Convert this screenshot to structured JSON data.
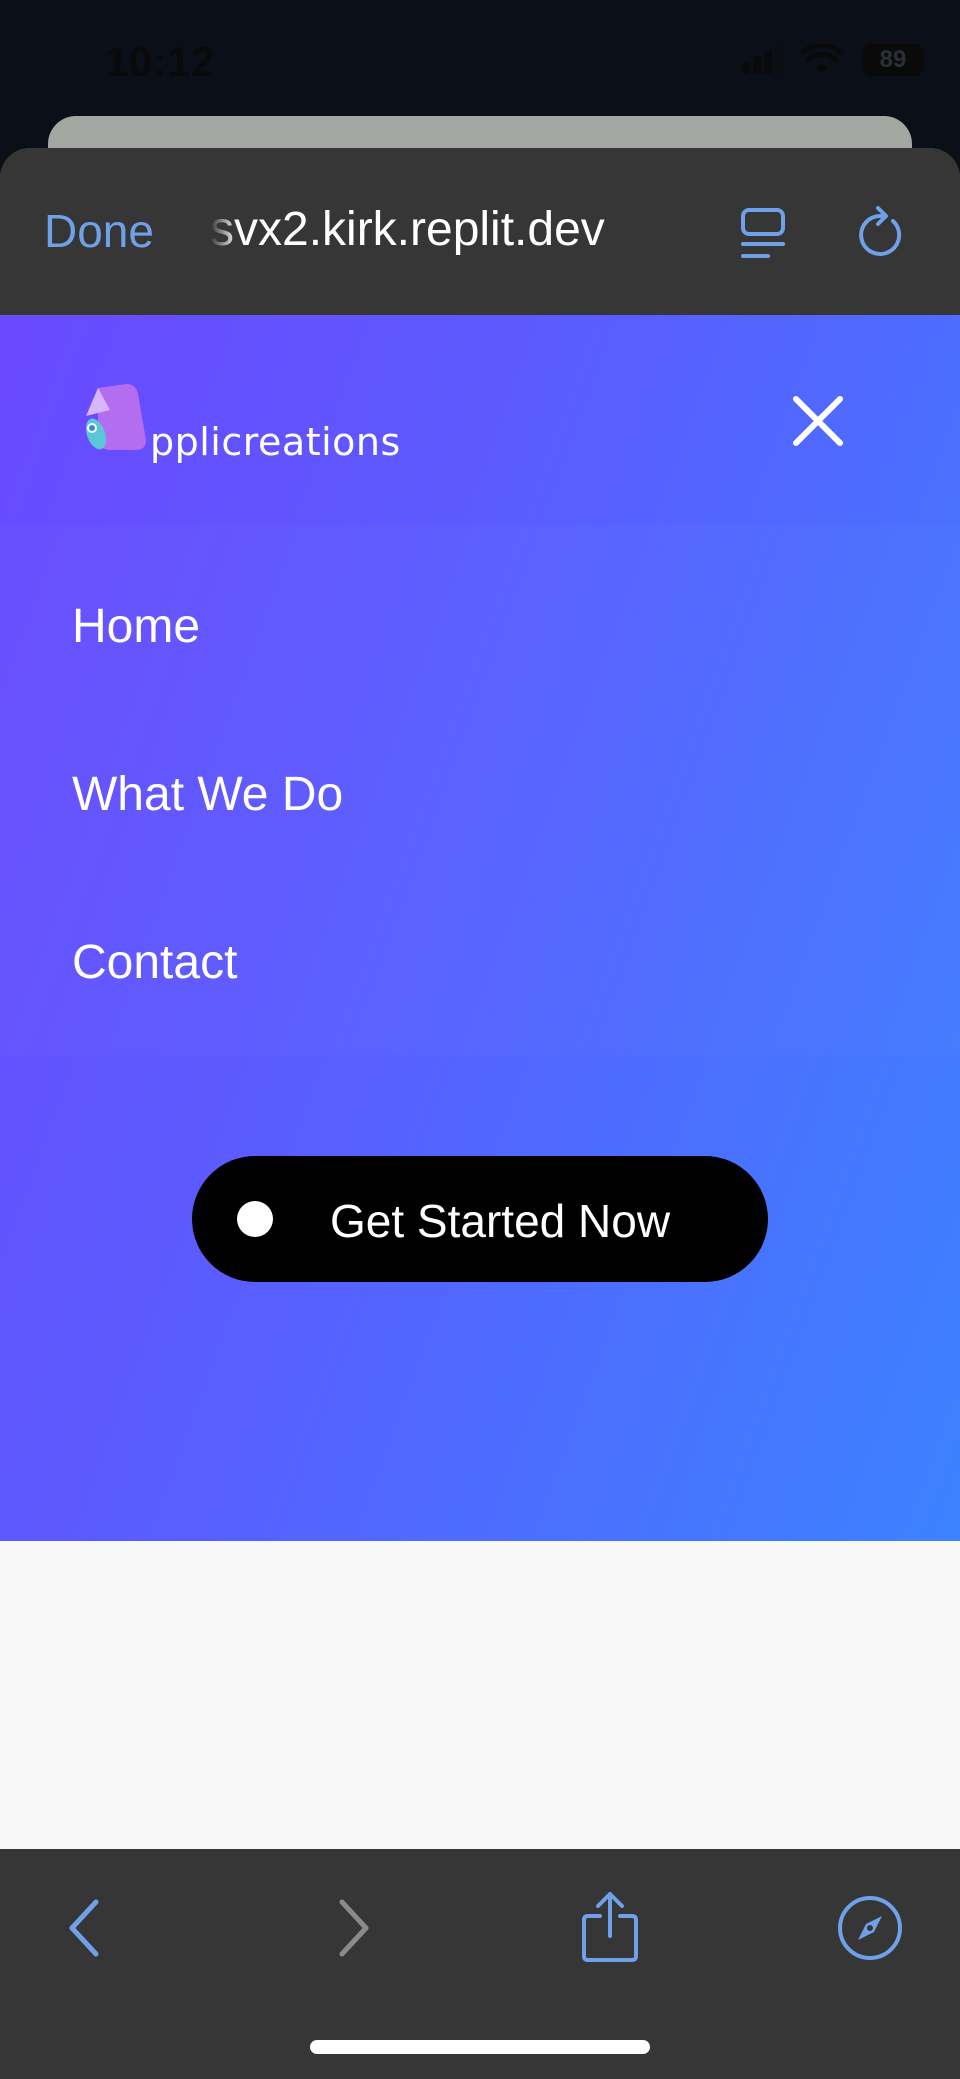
{
  "status_bar": {
    "time": "10:12",
    "battery": "89"
  },
  "browser": {
    "done_label": "Done",
    "url": "svx2.kirk.replit.dev"
  },
  "site": {
    "logo_text": "pplicreations",
    "menu_items": [
      {
        "label": "Home"
      },
      {
        "label": "What We Do"
      },
      {
        "label": "Contact"
      }
    ],
    "cta_label": "Get Started Now",
    "colors": {
      "gradient_start": "#6a49ff",
      "gradient_end": "#3c82ff",
      "cta_bg": "#000000"
    }
  },
  "icons": {
    "close": "close-icon",
    "back": "chevron-left-icon",
    "forward": "chevron-right-icon",
    "share": "share-icon",
    "compass": "compass-icon",
    "reader": "reader-icon",
    "reload": "reload-icon"
  },
  "colors": {
    "accent": "#6fa0e8",
    "chrome": "#363636"
  }
}
